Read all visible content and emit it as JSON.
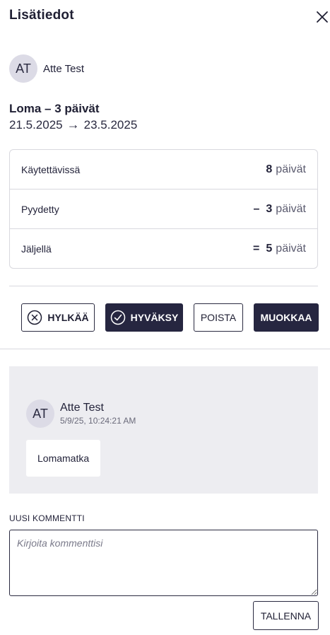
{
  "header": {
    "title": "Lisätiedot",
    "close_icon": "close-icon"
  },
  "requester": {
    "initials": "AT",
    "name": "Atte Test"
  },
  "leave": {
    "summary": "Loma – 3 päivät",
    "start_date": "21.5.2025",
    "arrow": "→",
    "end_date": "23.5.2025"
  },
  "balance": {
    "rows": [
      {
        "label": "Käytettävissä",
        "operator": "",
        "value": "8",
        "unit": "päivät"
      },
      {
        "label": "Pyydetty",
        "operator": "–",
        "value": "3",
        "unit": "päivät"
      },
      {
        "label": "Jäljellä",
        "operator": "=",
        "value": "5",
        "unit": "päivät"
      }
    ]
  },
  "actions": {
    "reject_label": "HYLKÄÄ",
    "approve_label": "HYVÄKSY",
    "delete_label": "POISTA",
    "edit_label": "MUOKKAA"
  },
  "comments": [
    {
      "initials": "AT",
      "author": "Atte Test",
      "timestamp": "5/9/25, 10:24:21 AM",
      "text": "Lomamatka"
    }
  ],
  "new_comment": {
    "label": "UUSI KOMMENTTI",
    "placeholder": "Kirjoita kommenttisi",
    "value": "",
    "save_label": "TALLENNA"
  },
  "colors": {
    "primary": "#262640",
    "border": "#d8d8de",
    "comment_bg": "#ededf1",
    "avatar_bg": "#dcdbe6"
  }
}
